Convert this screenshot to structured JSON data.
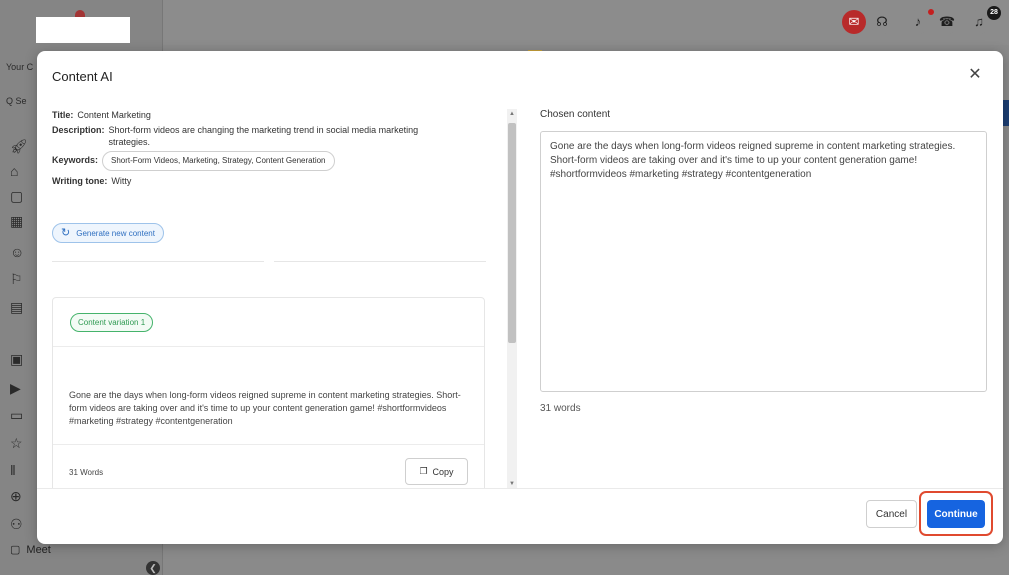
{
  "background_app": {
    "sidebar_labels": [
      "Your C",
      "Q Se"
    ],
    "sidebar_meet_label": "Meet",
    "notification_count": "28"
  },
  "modal": {
    "title": "Content AI",
    "close_icon": "close-icon",
    "meta": {
      "title_label": "Title:",
      "title_value": "Content Marketing",
      "description_label": "Description:",
      "description_value": "Short-form videos are changing the marketing trend in social media marketing strategies.",
      "keywords_label": "Keywords:",
      "keywords_value": "Short-Form Videos, Marketing, Strategy, Content Generation",
      "tone_label": "Writing tone:",
      "tone_value": "Witty"
    },
    "generate_button": "Generate new content",
    "variation": {
      "chip": "Content variation 1",
      "text": "Gone are the days when long-form videos reigned supreme in content marketing strategies. Short-form videos are taking over and it's time to up your content generation game! #shortformvideos #marketing #strategy #contentgeneration",
      "word_count": "31 Words",
      "copy_button": "Copy"
    },
    "chosen": {
      "label": "Chosen content",
      "text": "Gone are the days when long-form videos reigned supreme in content marketing strategies. Short-form videos are taking over and it's time to up your content generation game! #shortformvideos #marketing #strategy #contentgeneration",
      "word_count": "31 words"
    },
    "footer": {
      "cancel": "Cancel",
      "continue": "Continue"
    }
  },
  "colors": {
    "primary": "#1664e0",
    "highlight": "#e04a2f",
    "variation_green": "#45b36b",
    "generate_blue": "#2f6fc0"
  }
}
